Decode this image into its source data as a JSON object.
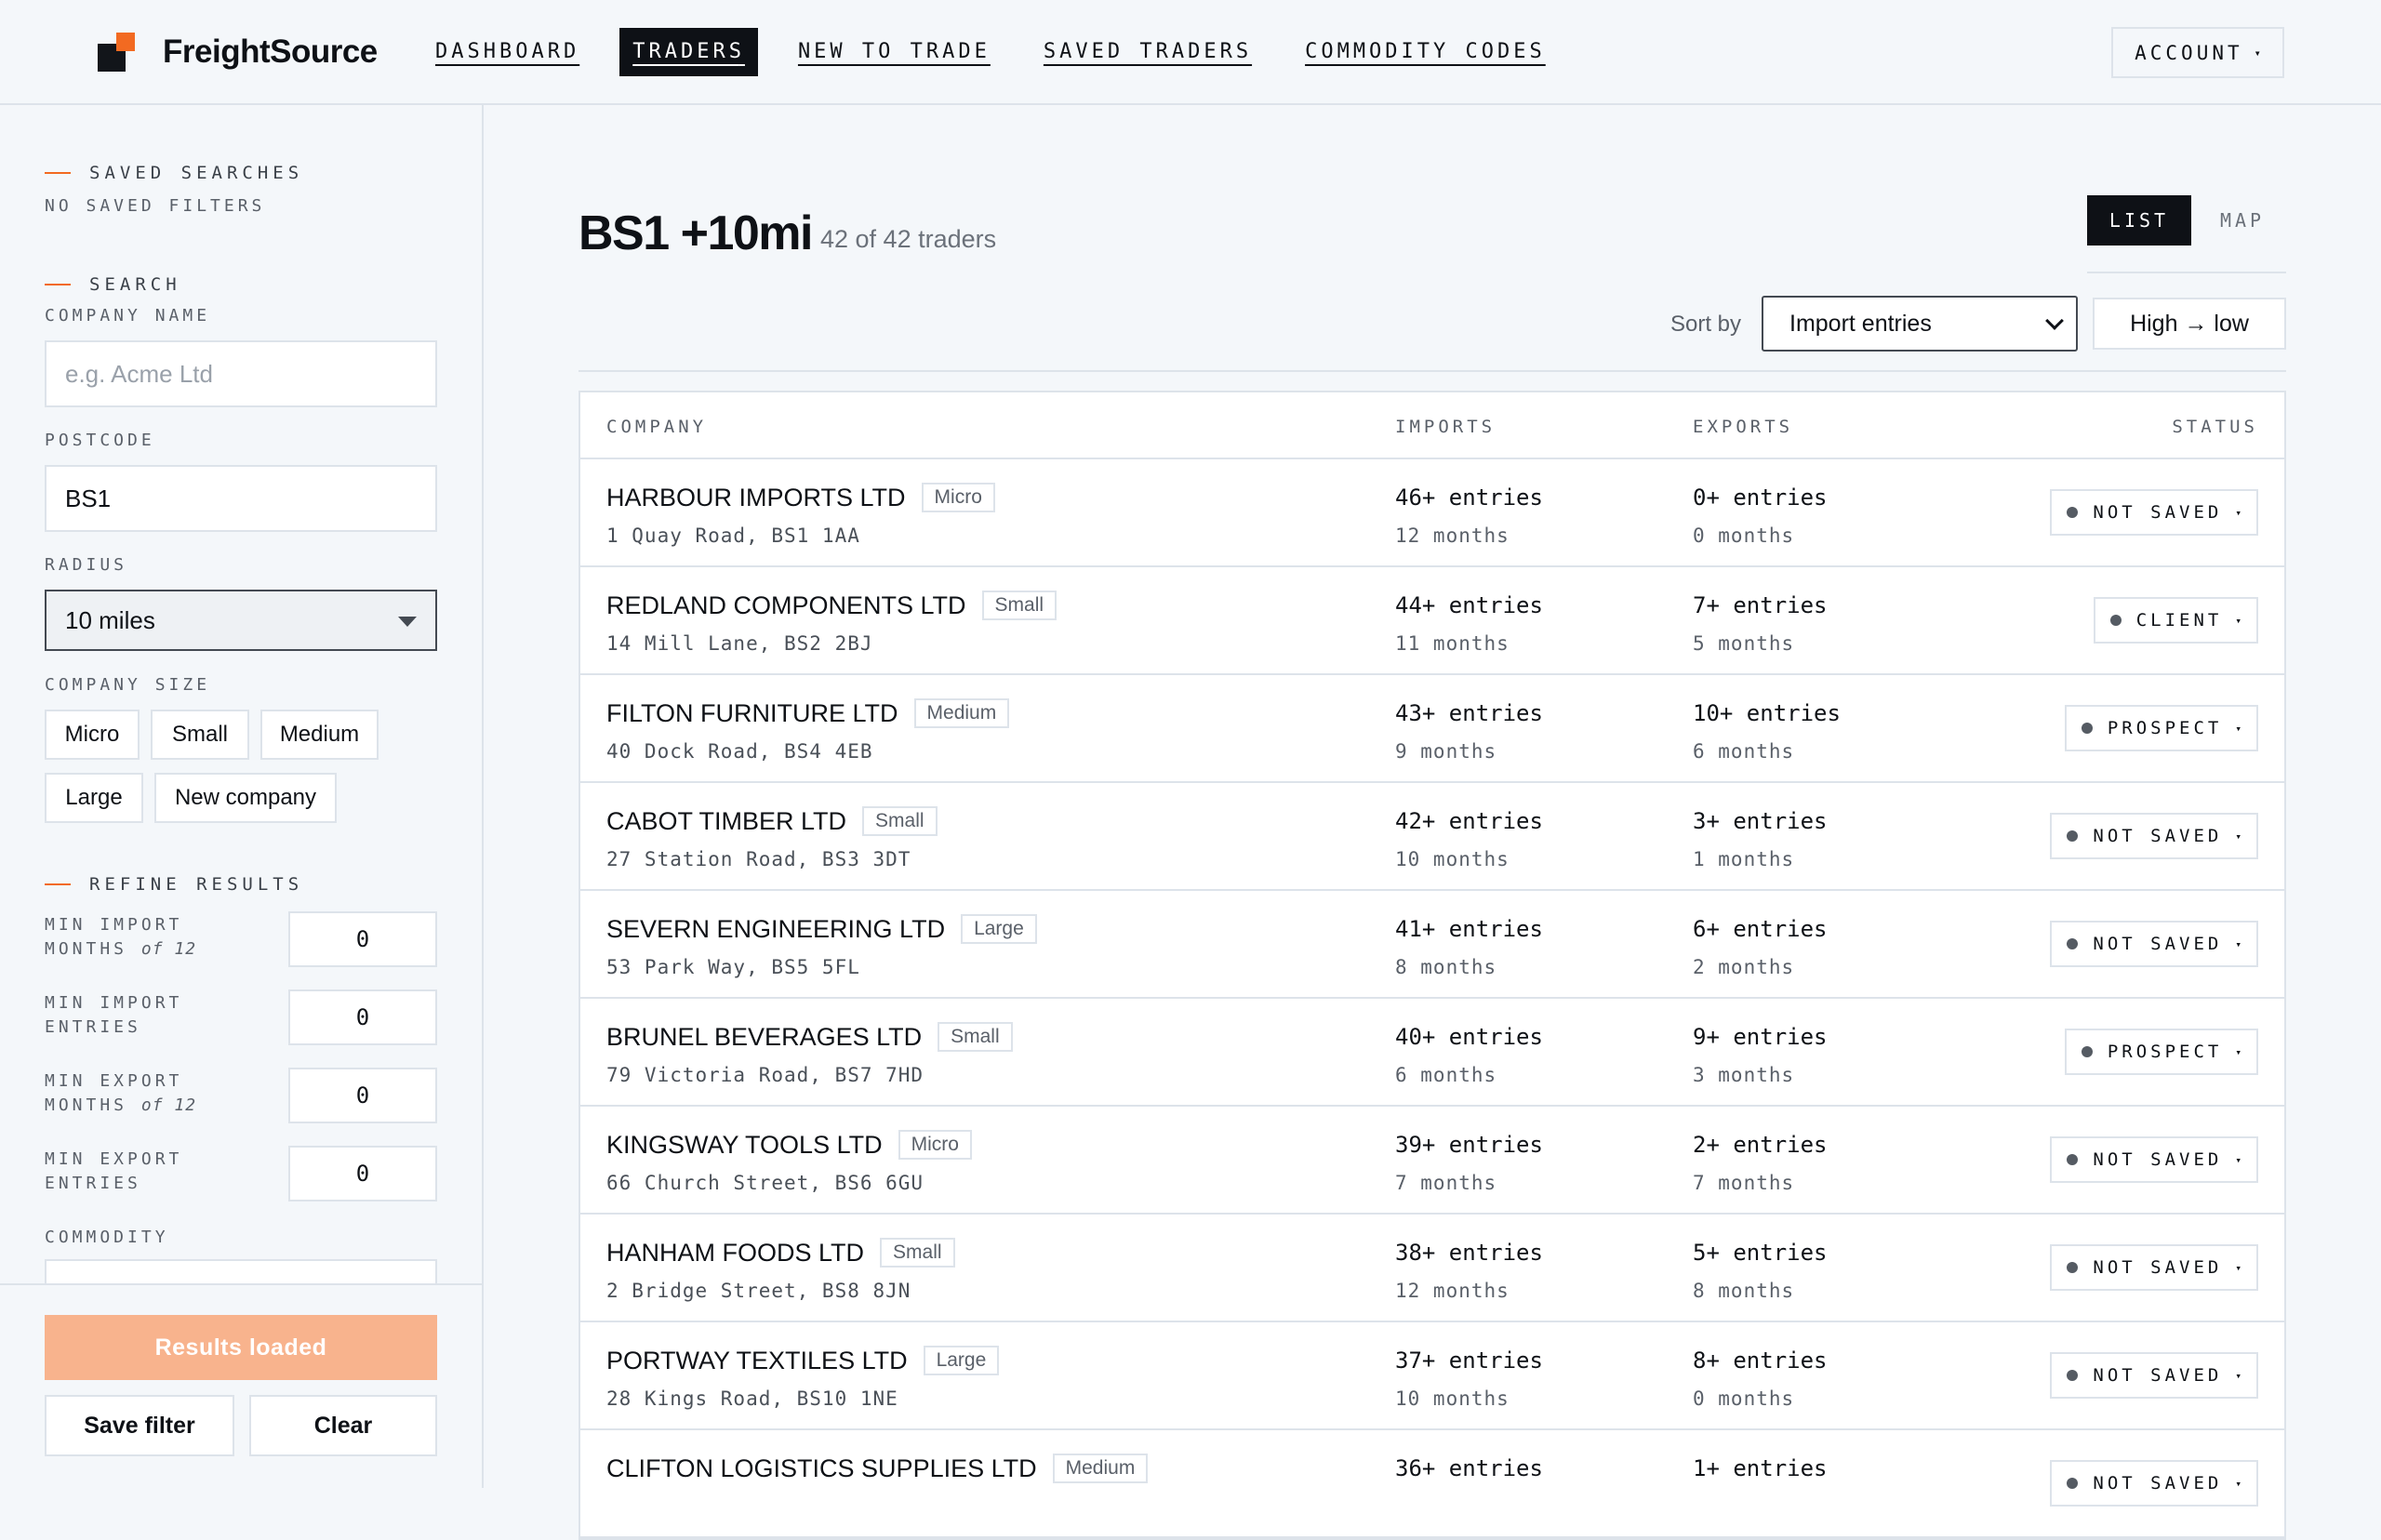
{
  "header": {
    "brand": "FreightSource",
    "nav": [
      {
        "label": "DASHBOARD",
        "active": false
      },
      {
        "label": "TRADERS",
        "active": true
      },
      {
        "label": "NEW TO TRADE",
        "active": false
      },
      {
        "label": "SAVED TRADERS",
        "active": false
      },
      {
        "label": "COMMODITY CODES",
        "active": false
      }
    ],
    "account_label": "ACCOUNT",
    "caret": "▾"
  },
  "sidebar": {
    "saved_searches_heading": "SAVED SEARCHES",
    "no_saved_filters": "NO SAVED FILTERS",
    "search_heading": "SEARCH",
    "company_name_label": "COMPANY NAME",
    "company_name_placeholder": "e.g. Acme Ltd",
    "postcode_label": "POSTCODE",
    "postcode_value": "BS1",
    "radius_label": "RADIUS",
    "radius_value": "10 miles",
    "company_size_label": "COMPANY SIZE",
    "sizes": [
      "Micro",
      "Small",
      "Medium",
      "Large",
      "New company"
    ],
    "refine_heading": "REFINE RESULTS",
    "refine": [
      {
        "line1": "MIN IMPORT",
        "line2": "MONTHS",
        "suffix": "of 12",
        "value": "0"
      },
      {
        "line1": "MIN IMPORT",
        "line2": "ENTRIES",
        "suffix": "",
        "value": "0"
      },
      {
        "line1": "MIN EXPORT",
        "line2": "MONTHS",
        "suffix": "of 12",
        "value": "0"
      },
      {
        "line1": "MIN EXPORT",
        "line2": "ENTRIES",
        "suffix": "",
        "value": "0"
      }
    ],
    "commodity_label": "COMMODITY",
    "results_button": "Results loaded",
    "save_filter_button": "Save filter",
    "clear_button": "Clear"
  },
  "main": {
    "title": "BS1 +10mi",
    "count": "42 of 42 traders",
    "view_list": "LIST",
    "view_map": "MAP",
    "sort_label": "Sort by",
    "sort_value": "Import entries",
    "order_label": "High → low",
    "columns": {
      "company": "COMPANY",
      "imports": "IMPORTS",
      "exports": "EXPORTS",
      "status": "STATUS"
    },
    "rows": [
      {
        "name": "HARBOUR IMPORTS LTD",
        "size": "Micro",
        "address": "1 Quay Road, BS1 1AA",
        "imports": "46+ entries",
        "import_months": "12 months",
        "exports": "0+ entries",
        "export_months": "0 months",
        "status": "NOT SAVED"
      },
      {
        "name": "REDLAND COMPONENTS LTD",
        "size": "Small",
        "address": "14 Mill Lane, BS2 2BJ",
        "imports": "44+ entries",
        "import_months": "11 months",
        "exports": "7+ entries",
        "export_months": "5 months",
        "status": "CLIENT"
      },
      {
        "name": "FILTON FURNITURE LTD",
        "size": "Medium",
        "address": "40 Dock Road, BS4 4EB",
        "imports": "43+ entries",
        "import_months": "9 months",
        "exports": "10+ entries",
        "export_months": "6 months",
        "status": "PROSPECT"
      },
      {
        "name": "CABOT TIMBER LTD",
        "size": "Small",
        "address": "27 Station Road, BS3 3DT",
        "imports": "42+ entries",
        "import_months": "10 months",
        "exports": "3+ entries",
        "export_months": "1 months",
        "status": "NOT SAVED"
      },
      {
        "name": "SEVERN ENGINEERING LTD",
        "size": "Large",
        "address": "53 Park Way, BS5 5FL",
        "imports": "41+ entries",
        "import_months": "8 months",
        "exports": "6+ entries",
        "export_months": "2 months",
        "status": "NOT SAVED"
      },
      {
        "name": "BRUNEL BEVERAGES LTD",
        "size": "Small",
        "address": "79 Victoria Road, BS7 7HD",
        "imports": "40+ entries",
        "import_months": "6 months",
        "exports": "9+ entries",
        "export_months": "3 months",
        "status": "PROSPECT"
      },
      {
        "name": "KINGSWAY TOOLS LTD",
        "size": "Micro",
        "address": "66 Church Street, BS6 6GU",
        "imports": "39+ entries",
        "import_months": "7 months",
        "exports": "2+ entries",
        "export_months": "7 months",
        "status": "NOT SAVED"
      },
      {
        "name": "HANHAM FOODS LTD",
        "size": "Small",
        "address": "2 Bridge Street, BS8 8JN",
        "imports": "38+ entries",
        "import_months": "12 months",
        "exports": "5+ entries",
        "export_months": "8 months",
        "status": "NOT SAVED"
      },
      {
        "name": "PORTWAY TEXTILES LTD",
        "size": "Large",
        "address": "28 Kings Road, BS10 1NE",
        "imports": "37+ entries",
        "import_months": "10 months",
        "exports": "8+ entries",
        "export_months": "0 months",
        "status": "NOT SAVED"
      },
      {
        "name": "CLIFTON LOGISTICS SUPPLIES LTD",
        "size": "Medium",
        "address": "",
        "imports": "36+ entries",
        "import_months": "",
        "exports": "1+ entries",
        "export_months": "",
        "status": "NOT SAVED"
      }
    ]
  },
  "colors": {
    "accent": "#f26a21",
    "accent_soft": "#f8b38d",
    "ink": "#0e1116",
    "border": "#dde3ea",
    "background": "#f4f7fa"
  }
}
